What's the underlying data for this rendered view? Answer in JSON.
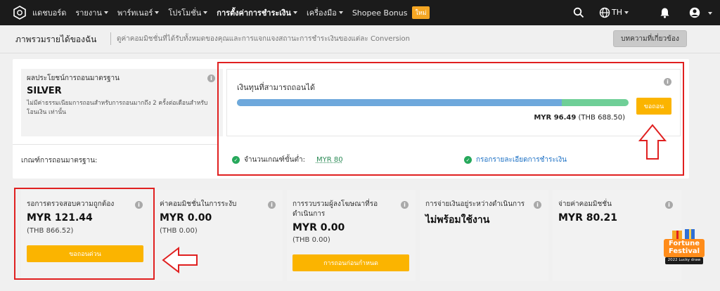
{
  "nav": {
    "items": [
      {
        "label": "แดชบอร์ด",
        "caret": false,
        "active": false
      },
      {
        "label": "รายงาน",
        "caret": true,
        "active": false
      },
      {
        "label": "พาร์ทเนอร์",
        "caret": true,
        "active": false
      },
      {
        "label": "โปรโมชั่น",
        "caret": true,
        "active": false
      },
      {
        "label": "การตั้งค่าการชำระเงิน",
        "caret": true,
        "active": true
      },
      {
        "label": "เครื่องมือ",
        "caret": true,
        "active": false
      },
      {
        "label": "Shopee Bonus",
        "caret": false,
        "active": false
      }
    ],
    "new_badge": "ใหม่",
    "language": "TH"
  },
  "subheader": {
    "title": "ภาพรวมรายได้ของฉัน",
    "description": "ดูค่าคอมมิชชั่นที่ได้รับทั้งหมดของคุณและการแจกแจงสถานะการชำระเงินของแต่ละ Conversion",
    "related_button": "บทความที่เกี่ยวข้อง"
  },
  "standard": {
    "label": "ผลประโยชน์การถอนมาตรฐาน",
    "level": "SILVER",
    "description": "ไม่มีค่าธรรมเนียมการถอนสำหรับการถอนมากถึง 2 ครั้งต่อเดือนสำหรับ โอนเงิน เท่านั้น",
    "criteria_label": "เกณฑ์การถอนมาตรฐาน:"
  },
  "withdrawable": {
    "title": "เงินทุนที่สามารถถอนได้",
    "amount": "MYR 96.49",
    "amount_alt": "(THB 688.50)",
    "fill_fraction": 0.83,
    "button": "ขอถอน",
    "min_label": "จำนวนเกณฑ์ขั้นต่ำ:",
    "min_value": "MYR 80",
    "details_link": "กรอกรายละเอียดการชำระเงิน"
  },
  "cards": [
    {
      "label": "รอการตรวจสอบความถูกต้อง",
      "value": "MYR 121.44",
      "sub": "(THB 866.52)",
      "button": "ขอถอนด่วน"
    },
    {
      "label": "ค่าคอมมิชชั่นในการระงับ",
      "value": "MYR 0.00",
      "sub": "(THB 0.00)",
      "button": ""
    },
    {
      "label": "การรวบรวมผู้ลงโฆษณาที่รอดำเนินการ",
      "value": "MYR 0.00",
      "sub": "(THB 0.00)",
      "button": "การถอนก่อนกำหนด"
    },
    {
      "label": "การจ่ายเงินอยู่ระหว่างดำเนินการ",
      "value": "ไม่พร้อมใช้งาน",
      "sub": "",
      "button": ""
    },
    {
      "label": "จ่ายค่าคอมมิชชั่น",
      "value": "MYR 80.21",
      "sub": "",
      "button": ""
    }
  ],
  "festival": {
    "line1": "Fortune",
    "line2": "Festival",
    "line3": "2022 Lucky draw"
  },
  "colors": {
    "nav_bg": "#1b1b1b",
    "accent": "#fbb400",
    "bar_blue": "#6ea8dc",
    "bar_green": "#6fcf97",
    "highlight_red": "#e02020"
  }
}
